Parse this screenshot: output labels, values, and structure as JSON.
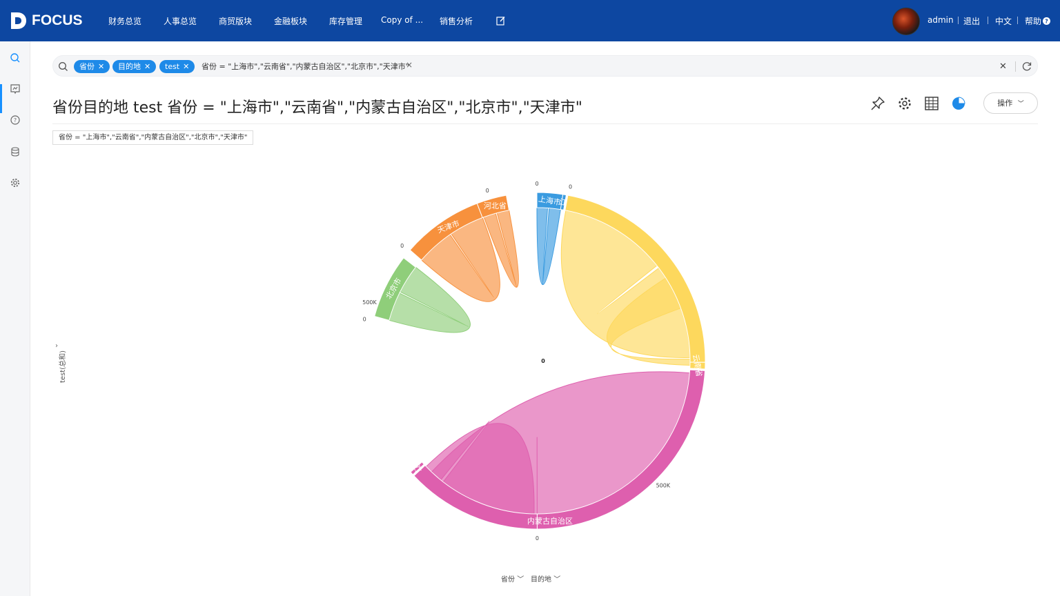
{
  "app": {
    "brand": "FOCUS"
  },
  "nav": {
    "items": [
      "财务总览",
      "人事总览",
      "商贸版块",
      "金融板块",
      "库存管理",
      "Copy of ...",
      "销售分析"
    ],
    "user": "admin",
    "logout": "退出",
    "lang": "中文",
    "help": "帮助"
  },
  "search": {
    "tags": [
      "省份",
      "目的地",
      "test"
    ],
    "filter": "省份 = \"上海市\",\"云南省\",\"内蒙古自治区\",\"北京市\",\"天津市\""
  },
  "page": {
    "title": "省份目的地 test 省份 = \"上海市\",\"云南省\",\"内蒙古自治区\",\"北京市\",\"天津市\"",
    "filter_chip": "省份 = \"上海市\",\"云南省\",\"内蒙古自治区\",\"北京市\",\"天津市\"",
    "op_button": "操作",
    "y_axis_label": "test(总和)",
    "bottom_fields": [
      "省份",
      "目的地"
    ]
  },
  "colors": {
    "nav_bg": "#0d47a1",
    "accent": "#1e8ae8",
    "shanghai": "#3a9be0",
    "yunnan": "#fdd85d",
    "neimenggu": "#de5fae",
    "beijing": "#8fce7a",
    "tianjin": "#f7913d"
  },
  "icons": [
    "search-icon",
    "bookmark-icon",
    "help-icon",
    "database-icon",
    "gear-icon",
    "edit-icon",
    "pin-icon",
    "settings-icon",
    "table-icon",
    "pie-icon",
    "refresh-icon",
    "close-icon"
  ],
  "chart_data": {
    "type": "chord",
    "title": "",
    "groups": [
      {
        "name": "上海市",
        "start": 0.0,
        "end": 0.155,
        "color": "#3a9be0"
      },
      {
        "name": "江",
        "start": 0.155,
        "end": 0.175,
        "color": "#3a9be0"
      },
      {
        "name": "云南省",
        "start": 0.185,
        "end": 1.58,
        "color": "#fdd85d"
      },
      {
        "name": "内蒙古自治区",
        "start": 1.58,
        "end": 1.62,
        "color": "#fdd85d"
      },
      {
        "name": "",
        "start": 1.63,
        "end": 3.14,
        "color": "#de5fae"
      },
      {
        "name": "内蒙古自治区",
        "start": 3.14,
        "end": 3.96,
        "color": "#de5fae"
      },
      {
        "name": "辽",
        "start": 3.97,
        "end": 3.99,
        "color": "#de5fae"
      },
      {
        "name": "北京市",
        "start": 4.98,
        "end": 5.37,
        "color": "#8fce7a"
      },
      {
        "name": "天津市",
        "start": 5.43,
        "end": 5.92,
        "color": "#f7913d"
      },
      {
        "name": "河北省",
        "start": 5.92,
        "end": 6.1,
        "color": "#f7913d"
      }
    ],
    "tick_labels": [
      "0",
      "500K",
      "0",
      "500K",
      "0",
      "0",
      "0",
      "0"
    ],
    "center_label": "0"
  }
}
